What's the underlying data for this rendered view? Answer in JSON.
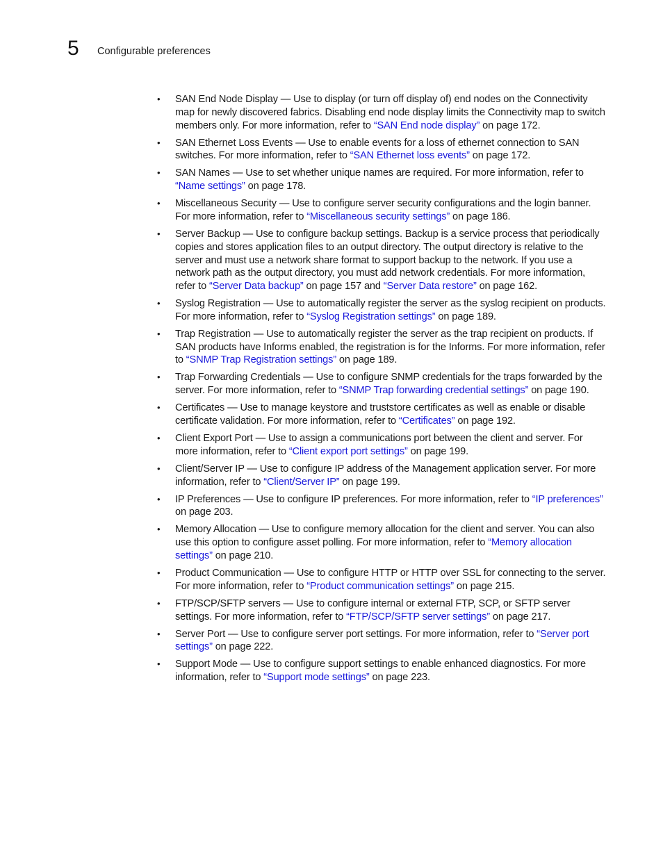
{
  "header": {
    "chapter_number": "5",
    "section_title": "Configurable preferences"
  },
  "colors": {
    "link": "#1a1adc",
    "text": "#1a1a1a"
  },
  "bullet_glyph": "•",
  "items": [
    {
      "parts": [
        {
          "t": "SAN End Node Display — Use to display (or turn off display of) end nodes on the Connectivity map for newly discovered fabrics. Disabling end node display limits the Connectivity map to switch members only. For more information, refer to "
        },
        {
          "link": "“SAN End node display”"
        },
        {
          "t": " on page 172."
        }
      ]
    },
    {
      "parts": [
        {
          "t": "SAN Ethernet Loss Events — Use to enable events for a loss of ethernet connection to SAN switches. For more information, refer to "
        },
        {
          "link": "“SAN Ethernet loss events”"
        },
        {
          "t": " on page 172."
        }
      ]
    },
    {
      "parts": [
        {
          "t": "SAN Names — Use to set whether unique names are required. For more information, refer to "
        },
        {
          "link": "“Name settings”"
        },
        {
          "t": " on page 178."
        }
      ]
    },
    {
      "parts": [
        {
          "t": "Miscellaneous Security — Use to configure server security configurations and the login banner. For more information, refer to "
        },
        {
          "link": "“Miscellaneous security settings”"
        },
        {
          "t": " on page 186."
        }
      ]
    },
    {
      "parts": [
        {
          "t": "Server Backup — Use to configure backup settings. Backup is a service process that periodically copies and stores application files to an output directory. The output directory is relative to the server and must use a network share format to support backup to the network. If you use a network path as the output directory, you must add network credentials. For more information, refer to "
        },
        {
          "link": "“Server Data backup”"
        },
        {
          "t": " on page 157 and "
        },
        {
          "link": "“Server Data restore”"
        },
        {
          "t": " on page 162."
        }
      ]
    },
    {
      "parts": [
        {
          "t": "Syslog Registration — Use to automatically register the server as the syslog recipient on products. For more information, refer to "
        },
        {
          "link": "“Syslog Registration settings”"
        },
        {
          "t": " on page 189."
        }
      ]
    },
    {
      "parts": [
        {
          "t": "Trap Registration — Use to automatically register the server as the trap recipient on products. If SAN products have Informs enabled, the registration is for the Informs. For more information, refer to "
        },
        {
          "link": "“SNMP Trap Registration settings”"
        },
        {
          "t": " on page 189."
        }
      ]
    },
    {
      "parts": [
        {
          "t": "Trap Forwarding Credentials — Use to configure SNMP credentials for the traps forwarded by the server. For more information, refer to "
        },
        {
          "link": "“SNMP Trap forwarding credential settings”"
        },
        {
          "t": " on page 190."
        }
      ]
    },
    {
      "parts": [
        {
          "t": "Certificates — Use to manage keystore and truststore certificates as well as enable or disable certificate validation. For more information, refer to "
        },
        {
          "link": "“Certificates”"
        },
        {
          "t": " on page 192."
        }
      ]
    },
    {
      "parts": [
        {
          "t": "Client Export Port — Use to assign a communications port between the client and server. For more information, refer to "
        },
        {
          "link": "“Client export port settings”"
        },
        {
          "t": " on page 199."
        }
      ]
    },
    {
      "parts": [
        {
          "t": "Client/Server IP — Use to configure IP address of the Management application server. For more information, refer to "
        },
        {
          "link": "“Client/Server IP”"
        },
        {
          "t": " on page 199."
        }
      ]
    },
    {
      "parts": [
        {
          "t": "IP Preferences — Use to configure IP preferences. For more information, refer to "
        },
        {
          "link": "“IP preferences”"
        },
        {
          "t": " on page 203."
        }
      ]
    },
    {
      "parts": [
        {
          "t": "Memory Allocation — Use to configure memory allocation for the client and server. You can also use this option to configure asset polling. For more information, refer to "
        },
        {
          "link": "“Memory allocation settings”"
        },
        {
          "t": " on page 210."
        }
      ]
    },
    {
      "parts": [
        {
          "t": "Product Communication — Use to configure HTTP or HTTP over SSL for connecting to the server. For more information, refer to "
        },
        {
          "link": "“Product communication settings”"
        },
        {
          "t": " on page 215."
        }
      ]
    },
    {
      "parts": [
        {
          "t": "FTP/SCP/SFTP servers —  Use to configure internal or external FTP, SCP, or SFTP server settings. For more information, refer to "
        },
        {
          "link": "“FTP/SCP/SFTP server settings”"
        },
        {
          "t": " on page 217."
        }
      ]
    },
    {
      "parts": [
        {
          "t": "Server Port — Use to configure server port settings. For more information, refer to "
        },
        {
          "link": "“Server port settings”"
        },
        {
          "t": " on page 222."
        }
      ]
    },
    {
      "parts": [
        {
          "t": "Support Mode — Use to configure support settings to enable enhanced diagnostics. For more information, refer to "
        },
        {
          "link": "“Support mode settings”"
        },
        {
          "t": " on page 223."
        }
      ]
    }
  ]
}
